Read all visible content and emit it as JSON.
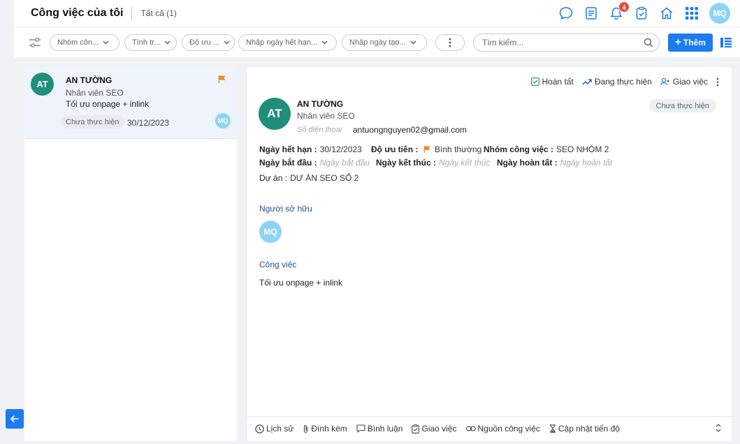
{
  "header": {
    "title": "Công việc của tôi",
    "count_label": "Tất cả (1)",
    "notification_count": "4",
    "user_initials": "MQ"
  },
  "filters": {
    "group": "Nhóm côn...",
    "status": "Tình tr...",
    "priority": "Độ ưu ...",
    "due_date": "Nhập ngày hết hạn...",
    "created_date": "Nhập ngày tạo...",
    "search_placeholder": "Tìm kiếm...",
    "add_label": "Thêm"
  },
  "task_list": [
    {
      "initials": "AT",
      "name": "AN TƯỜNG",
      "role": "Nhân viên SEO",
      "task": "Tối ưu onpage + inlink",
      "status": "Chưa thực hiện",
      "date": "30/12/2023",
      "assignee": "MQ"
    }
  ],
  "detail": {
    "actions": {
      "complete": "Hoàn tất",
      "in_progress": "Đang thực hiện",
      "assign": "Giao việc"
    },
    "status": "Chưa thực hiện",
    "initials": "AT",
    "name": "AN TƯỜNG",
    "role": "Nhân viên SEO",
    "phone_placeholder": "Số điện thoại",
    "email": "antuongnguyen02@gmail.com",
    "due_label": "Ngày hết hạn :",
    "due_value": "30/12/2023",
    "priority_label": "Độ ưu tiên :",
    "priority_value": "Bình thường",
    "group_label": "Nhóm công việc :",
    "group_value": "SEO NHÓM 2",
    "start_label": "Ngày bắt đầu :",
    "start_placeholder": "Ngày bắt đầu",
    "end_label": "Ngày kết thúc :",
    "end_placeholder": "Ngày kết thúc",
    "done_label": "Ngày hoàn tất :",
    "done_placeholder": "Ngày hoàn tất",
    "project_label": "Dự án :",
    "project_value": "DỰ ÁN SEO SỐ 2",
    "owner_title": "Người sở hữu",
    "owner_initials": "MQ",
    "task_title": "Công việc",
    "task_value": "Tối ưu onpage + inlink"
  },
  "bottom_tabs": {
    "history": "Lịch sử",
    "attachments": "Đính kèm",
    "comments": "Bình luận",
    "assign": "Giao việc",
    "source": "Nguồn công việc",
    "progress": "Cập nhật tiến độ"
  },
  "colors": {
    "primary": "#1a7cf0",
    "avatar_green": "#1f8f7c",
    "avatar_blue": "#8fd3f6",
    "flag_orange": "#f08a24",
    "badge_red": "#e74c3c"
  }
}
